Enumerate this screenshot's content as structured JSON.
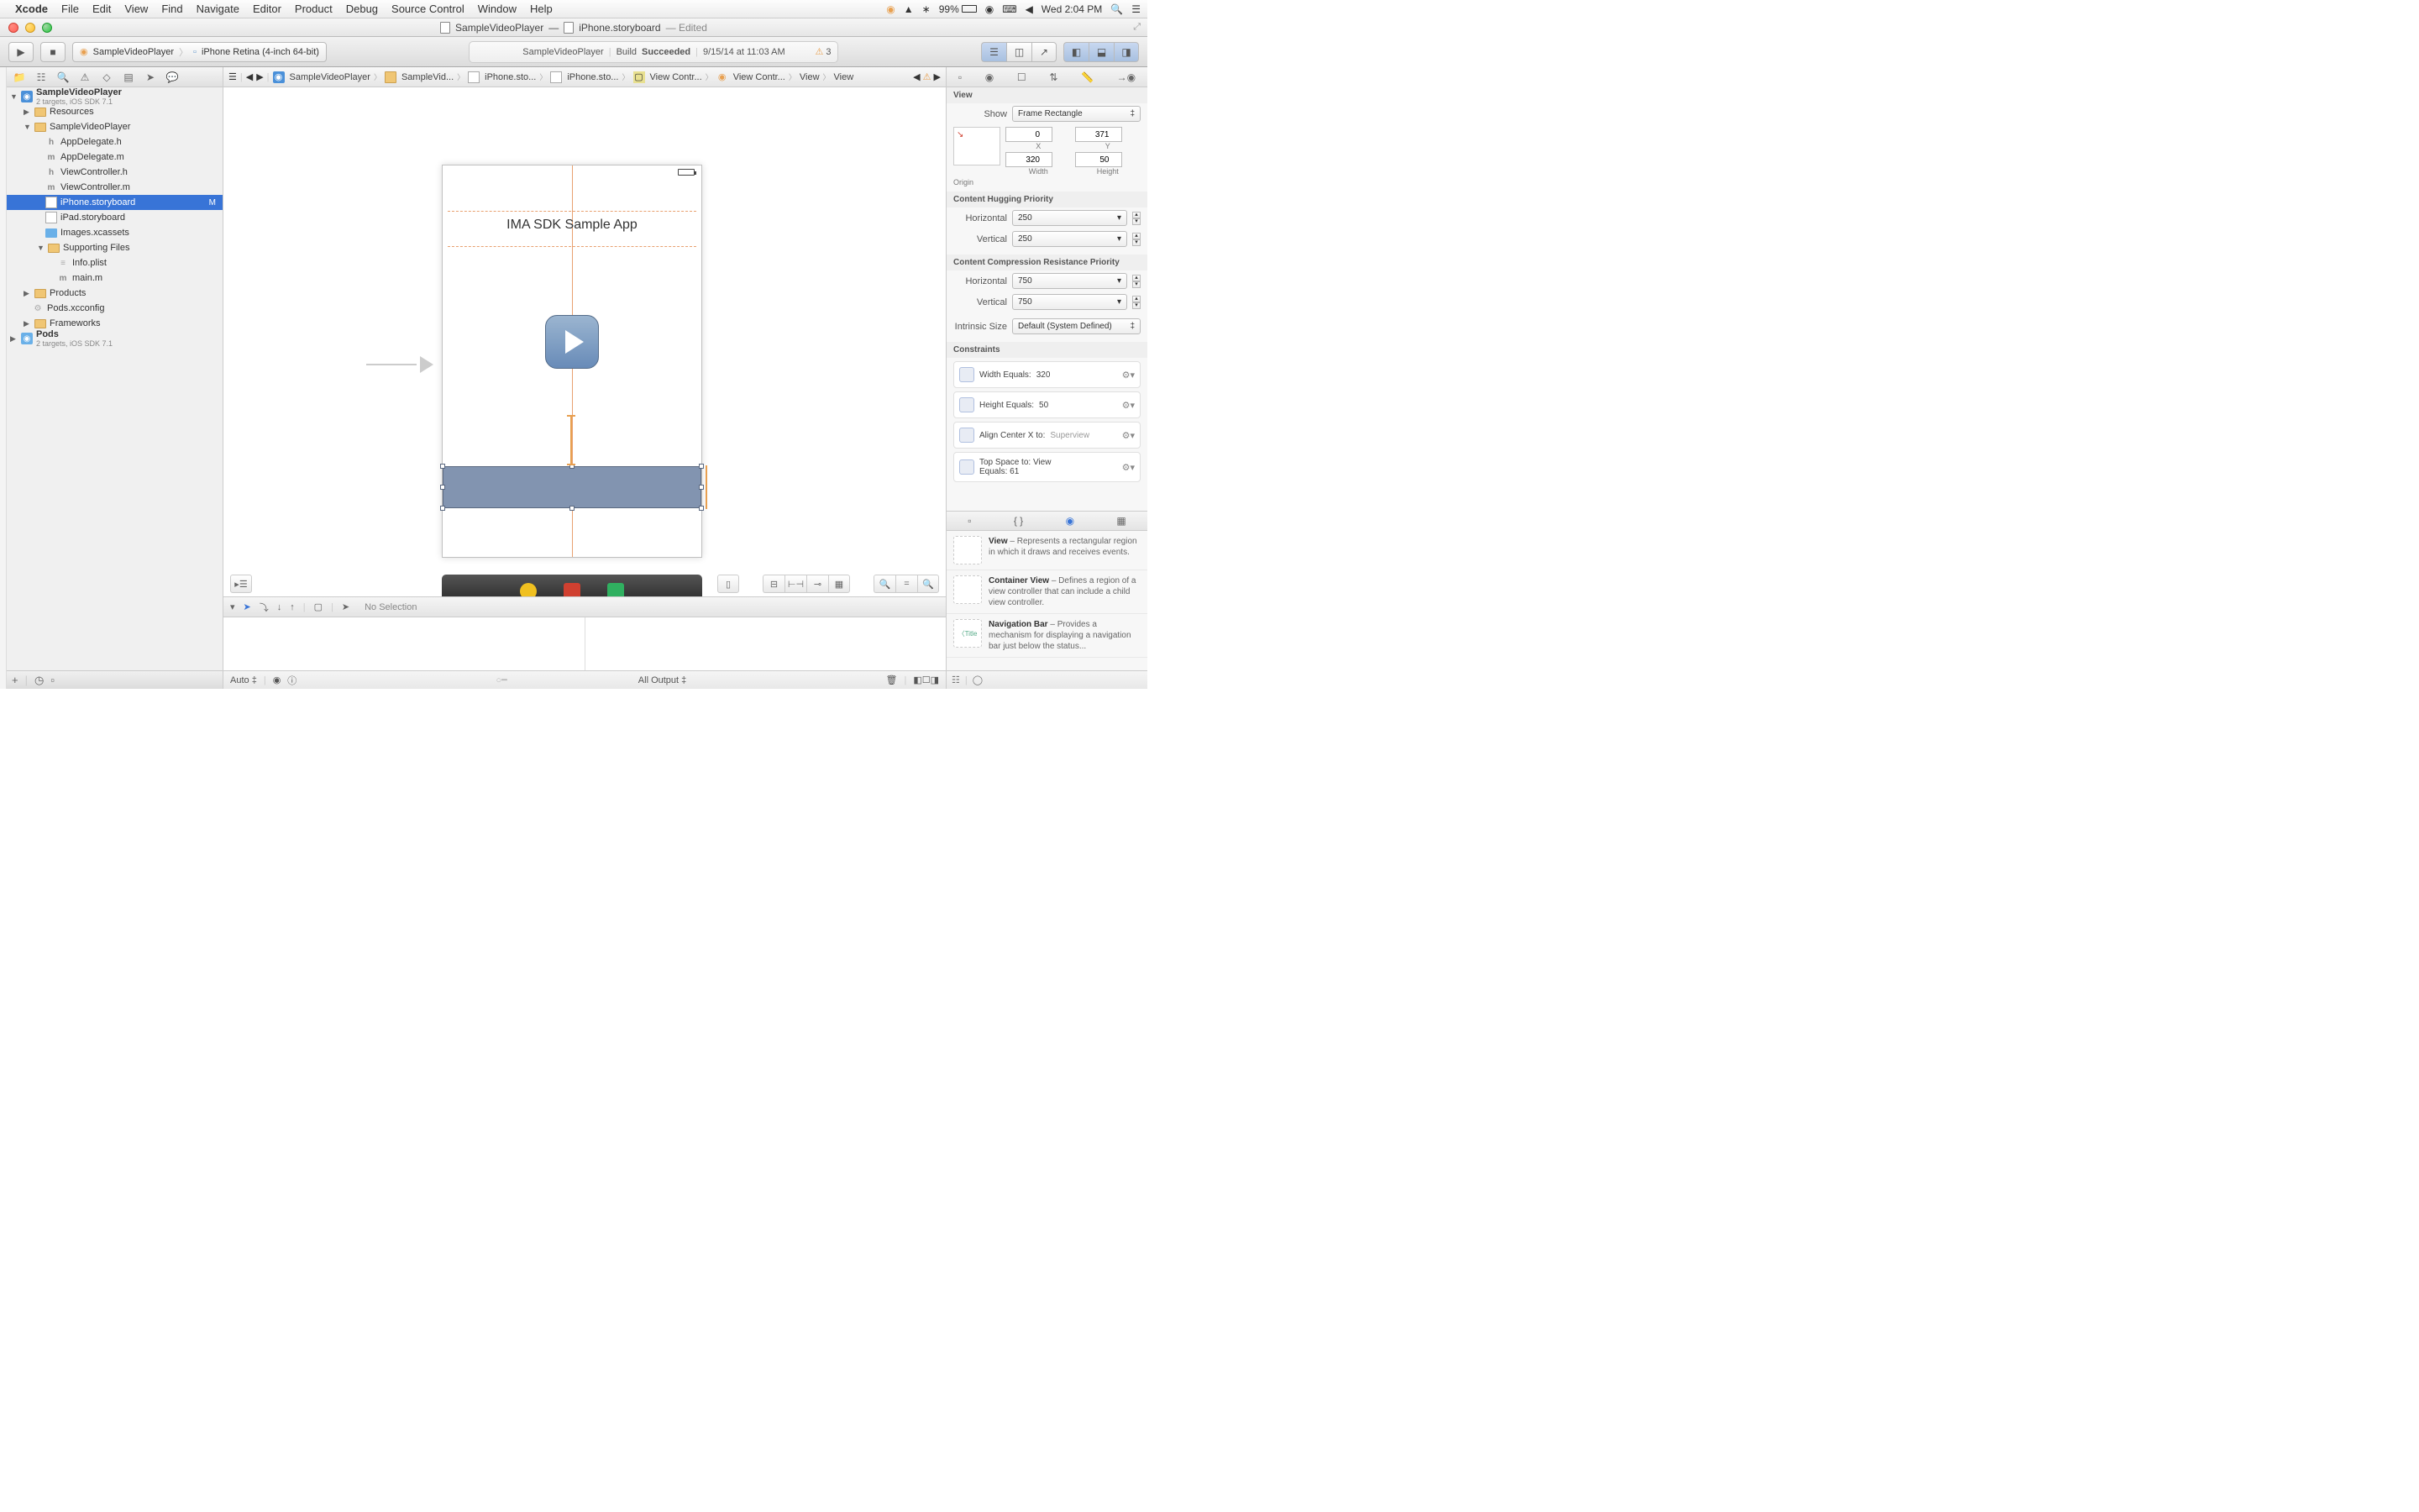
{
  "menubar": {
    "app": "Xcode",
    "items": [
      "File",
      "Edit",
      "View",
      "Find",
      "Navigate",
      "Editor",
      "Product",
      "Debug",
      "Source Control",
      "Window",
      "Help"
    ],
    "battery": "99%",
    "clock": "Wed 2:04 PM"
  },
  "titlebar": {
    "doc1": "SampleVideoPlayer",
    "dash": "—",
    "doc2": "iPhone.storyboard",
    "status": "— Edited"
  },
  "toolbar": {
    "scheme_target": "SampleVideoPlayer",
    "scheme_device": "iPhone Retina (4-inch 64-bit)",
    "activity_name": "SampleVideoPlayer",
    "activity_status": "Build",
    "activity_result": "Succeeded",
    "activity_time": "9/15/14 at 11:03 AM",
    "warn_count": "3"
  },
  "navigator": {
    "project": "SampleVideoPlayer",
    "project_sub": "2 targets, iOS SDK 7.1",
    "tree": {
      "resources": "Resources",
      "group": "SampleVideoPlayer",
      "appdelegate_h": "AppDelegate.h",
      "appdelegate_m": "AppDelegate.m",
      "viewcontroller_h": "ViewController.h",
      "viewcontroller_m": "ViewController.m",
      "iphone_sb": "iPhone.storyboard",
      "iphone_badge": "M",
      "ipad_sb": "iPad.storyboard",
      "images": "Images.xcassets",
      "supporting": "Supporting Files",
      "info": "Info.plist",
      "main_m": "main.m",
      "products": "Products",
      "podsxc": "Pods.xcconfig",
      "frameworks": "Frameworks",
      "pods": "Pods",
      "pods_sub": "2 targets, iOS SDK 7.1"
    }
  },
  "jumpbar": {
    "items": [
      "SampleVideoPlayer",
      "SampleVid...",
      "iPhone.sto...",
      "iPhone.sto...",
      "View Contr...",
      "View Contr...",
      "View",
      "View"
    ]
  },
  "canvas": {
    "label_text": "IMA SDK Sample App"
  },
  "debug": {
    "no_selection": "No Selection",
    "auto": "Auto",
    "all_output": "All Output"
  },
  "inspector": {
    "title": "View",
    "show_label": "Show",
    "show_value": "Frame Rectangle",
    "x": "0",
    "y": "371",
    "width": "320",
    "height": "50",
    "x_label": "X",
    "y_label": "Y",
    "w_label": "Width",
    "h_label": "Height",
    "origin_label": "Origin",
    "hugging_title": "Content Hugging Priority",
    "hugging_h_label": "Horizontal",
    "hugging_h": "250",
    "hugging_v_label": "Vertical",
    "hugging_v": "250",
    "compression_title": "Content Compression Resistance Priority",
    "compression_h_label": "Horizontal",
    "compression_h": "750",
    "compression_v_label": "Vertical",
    "compression_v": "750",
    "intrinsic_label": "Intrinsic Size",
    "intrinsic_value": "Default (System Defined)",
    "constraints_title": "Constraints",
    "constraints": [
      {
        "label": "Width Equals:",
        "value": "320"
      },
      {
        "label": "Height Equals:",
        "value": "50"
      },
      {
        "label": "Align Center X to:",
        "value": "Superview"
      },
      {
        "label": "Top Space to:",
        "value": "View",
        "label2": "Equals:",
        "value2": "61"
      }
    ]
  },
  "library": {
    "items": [
      {
        "name": "View",
        "desc": " – Represents a rectangular region in which it draws and receives events."
      },
      {
        "name": "Container View",
        "desc": " – Defines a region of a view controller that can include a child view controller."
      },
      {
        "name": "Navigation Bar",
        "desc": " – Provides a mechanism for displaying a navigation bar just below the status..."
      }
    ],
    "back_label": "Title"
  }
}
